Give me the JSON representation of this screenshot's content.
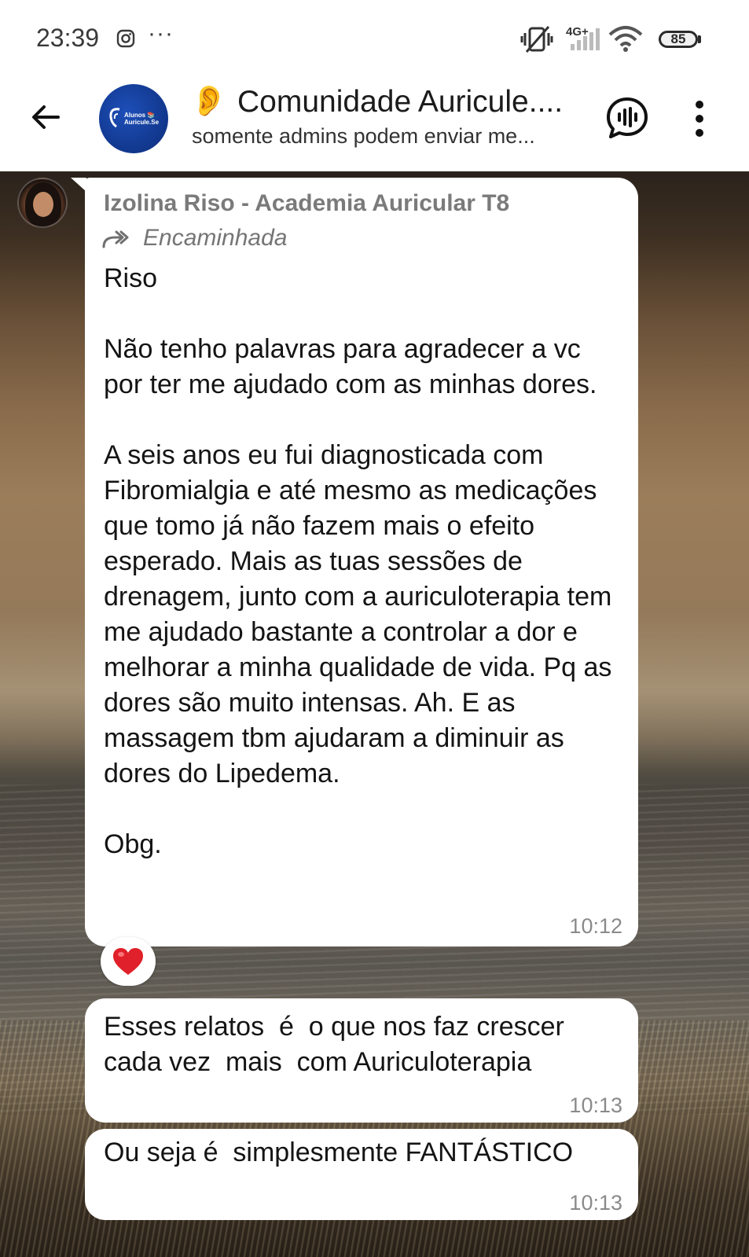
{
  "status_bar": {
    "time": "23:39",
    "more": "···",
    "network": "4G+",
    "battery": "85"
  },
  "header": {
    "title_emoji": "👂",
    "title": "Comunidade Auricule....",
    "subtitle": "somente admins podem enviar me...",
    "avatar_text_line1": "Alunos 📚",
    "avatar_text_line2": "Auricule.Se"
  },
  "messages": [
    {
      "sender": "Izolina Riso - Academia Auricular T8",
      "forwarded_label": "Encaminhada",
      "text": "Riso\n\nNão tenho palavras para agradecer a vc por ter me ajudado com as minhas dores.\n\nA seis anos eu fui diagnosticada com Fibromialgia e até mesmo as medicações que tomo já não fazem mais o efeito esperado. Mais as tuas sessões de drenagem, junto com a auriculoterapia tem me ajudado bastante a controlar a dor e melhorar a minha qualidade de vida. Pq as dores são muito intensas. Ah. E as massagem tbm ajudaram a diminuir as dores do Lipedema.\n\nObg.",
      "time": "10:12",
      "reaction": "heart"
    },
    {
      "text": "Esses relatos  é  o que nos faz crescer cada vez  mais  com Auriculoterapia",
      "time": "10:13"
    },
    {
      "text": "Ou seja é  simplesmente FANTÁSTICO",
      "time": "10:13"
    }
  ],
  "colors": {
    "bubble": "#ffffff",
    "header_bg": "#ffffff",
    "avatar_blue": "#1d4fb8",
    "reaction_heart": "#e0202a"
  },
  "icons": [
    "back-arrow-icon",
    "instagram-icon",
    "vibrate-off-icon",
    "signal-icon",
    "wifi-icon",
    "battery-icon",
    "voice-chat-icon",
    "more-vert-icon",
    "forward-icon",
    "heart-icon"
  ]
}
